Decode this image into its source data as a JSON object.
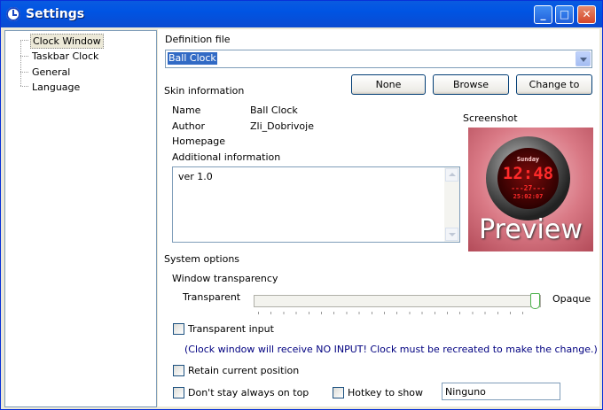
{
  "window": {
    "title": "Settings"
  },
  "sidebar": {
    "items": [
      "Clock Window",
      "Taskbar Clock",
      "General",
      "Language"
    ]
  },
  "definition": {
    "label": "Definition file",
    "value": "Ball Clock"
  },
  "buttons": {
    "none": "None",
    "browse": "Browse",
    "change": "Change to"
  },
  "skin": {
    "section": "Skin information",
    "name_label": "Name",
    "name_value": "Ball Clock",
    "author_label": "Author",
    "author_value": "Zli_Dobrivoje",
    "homepage_label": "Homepage",
    "additional_label": "Additional information",
    "additional_value": "ver 1.0"
  },
  "screenshot": {
    "label": "Screenshot",
    "preview_text": "Preview",
    "day": "Sunday",
    "time": "12:48",
    "date": "---27---",
    "seconds": "25:02:07"
  },
  "system": {
    "section": "System options",
    "transparency_label": "Window transparency",
    "transparent": "Transparent",
    "opaque": "Opaque",
    "transparency_value": 1.0,
    "transparent_input": "Transparent input",
    "note": "(Clock window will receive NO INPUT! Clock must be recreated to make the change.)",
    "retain": "Retain current position",
    "dont_stay": "Don't stay always on top",
    "hotkey_label": "Hotkey to show",
    "hotkey_value": "Ninguno"
  },
  "colors": {
    "title_bar": "#0054E3",
    "selection": "#316AC5",
    "note": "#000080"
  }
}
